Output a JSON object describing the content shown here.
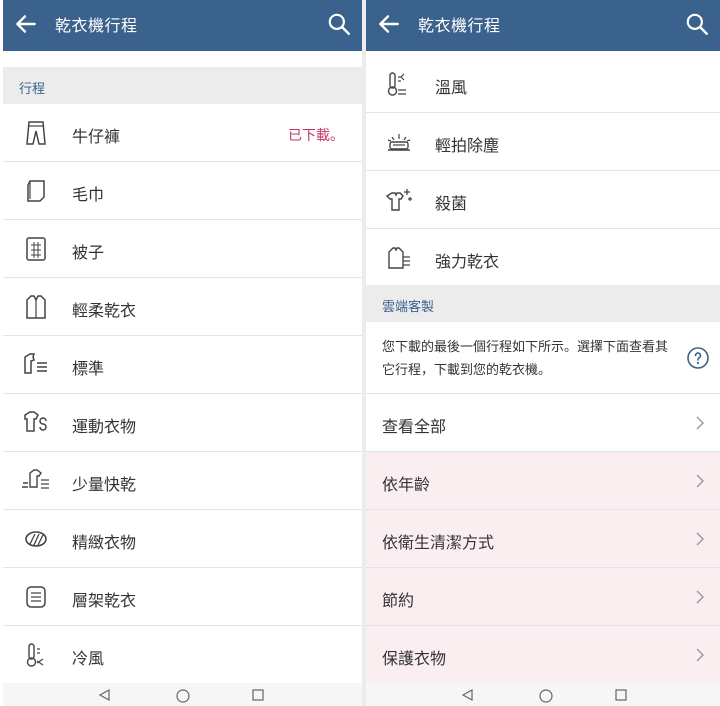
{
  "left": {
    "appbar": {
      "title": "乾衣機行程",
      "back_icon": "arrow-back-icon",
      "search_icon": "search-icon"
    },
    "section_label": "行程",
    "rows": [
      {
        "label": "牛仔褲",
        "badge": "已下載。",
        "icon": "jeans-icon"
      },
      {
        "label": "毛巾",
        "icon": "towel-icon"
      },
      {
        "label": "被子",
        "icon": "quilt-icon"
      },
      {
        "label": "輕柔乾衣",
        "icon": "shirt-icon"
      },
      {
        "label": "標準",
        "icon": "standard-icon"
      },
      {
        "label": "運動衣物",
        "icon": "sportswear-icon"
      },
      {
        "label": "少量快乾",
        "icon": "quick-dry-icon"
      },
      {
        "label": "精緻衣物",
        "icon": "delicates-icon"
      },
      {
        "label": "層架乾衣",
        "icon": "rack-dry-icon"
      },
      {
        "label": "冷風",
        "icon": "cool-air-icon"
      }
    ]
  },
  "right": {
    "appbar": {
      "title": "乾衣機行程",
      "back_icon": "arrow-back-icon",
      "search_icon": "search-icon"
    },
    "rows": [
      {
        "label": "溫風",
        "icon": "warm-air-icon"
      },
      {
        "label": "輕拍除塵",
        "icon": "air-fluff-icon"
      },
      {
        "label": "殺菌",
        "icon": "sanitize-icon"
      },
      {
        "label": "強力乾衣",
        "icon": "turbo-dry-icon"
      }
    ],
    "section_label": "雲端客製",
    "info_text": "您下載的最後一個行程如下所示。選擇下面查看其它行程，下載到您的乾衣機。",
    "view_all": "查看全部",
    "categories": [
      "依年齡",
      "依衛生清潔方式",
      "節約",
      "保護衣物"
    ]
  },
  "colors": {
    "appbar": "#3a628c",
    "badge": "#c0386a",
    "section_bg": "#ececec",
    "pink_row": "#fbeef0"
  }
}
